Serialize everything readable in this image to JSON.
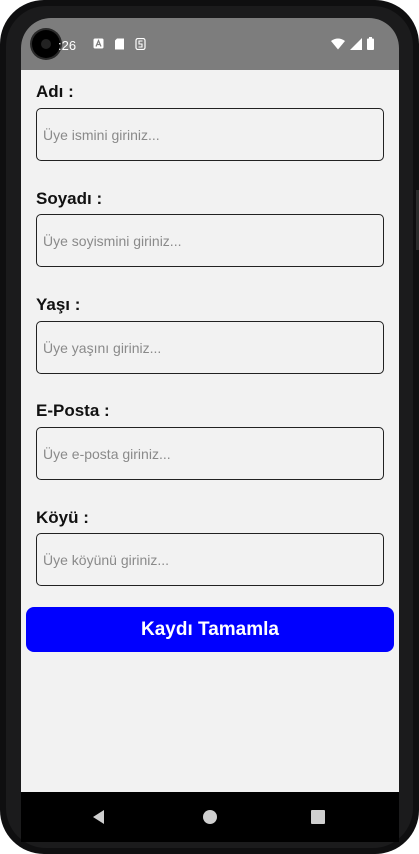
{
  "status_bar": {
    "time": ":26",
    "icons": [
      "a-notification-icon",
      "sd-card-icon",
      "s-notification-icon",
      "wifi-icon",
      "signal-icon",
      "battery-icon"
    ]
  },
  "form": {
    "fields": [
      {
        "label": "Adı :",
        "placeholder": "Üye ismini giriniz..."
      },
      {
        "label": "Soyadı :",
        "placeholder": "Üye soyismini giriniz..."
      },
      {
        "label": "Yaşı :",
        "placeholder": "Üye yaşını giriniz..."
      },
      {
        "label": "E-Posta :",
        "placeholder": "Üye e-posta giriniz..."
      },
      {
        "label": "Köyü  :",
        "placeholder": "Üye köyünü giriniz..."
      }
    ],
    "submit_label": "Kaydı Tamamla"
  },
  "colors": {
    "button": "#0000ff",
    "status_bar": "#7d7d7d",
    "background": "#f2f2f2"
  },
  "nav_bar": {
    "buttons": [
      "back-icon",
      "home-icon",
      "recents-icon"
    ]
  }
}
